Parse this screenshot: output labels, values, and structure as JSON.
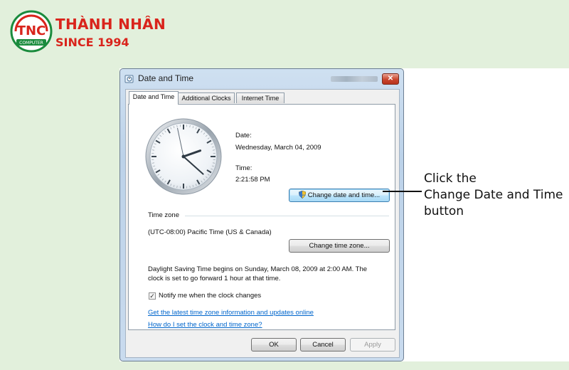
{
  "brand": {
    "logo_text": "TNC",
    "logo_sub": "COMPUTER",
    "name": "THÀNH NHÂN",
    "since": "SINCE 1994",
    "color": "#d9241c"
  },
  "dialog": {
    "title": "Date and Time",
    "close_label": "✕",
    "tabs": [
      {
        "label": "Date and Time",
        "active": true
      },
      {
        "label": "Additional Clocks",
        "active": false
      },
      {
        "label": "Internet Time",
        "active": false
      }
    ],
    "clock": {
      "hour": 2,
      "minute": 21,
      "second": 58
    },
    "date_label": "Date:",
    "date_value": "Wednesday, March 04, 2009",
    "time_label": "Time:",
    "time_value": "2:21:58 PM",
    "change_datetime_button": "Change date and time...",
    "timezone_header": "Time zone",
    "timezone_value": "(UTC-08:00) Pacific Time (US & Canada)",
    "change_timezone_button": "Change time zone...",
    "dst_line1": "Daylight Saving Time begins on Sunday, March 08, 2009 at 2:00 AM. The",
    "dst_line2": "clock is set to go forward 1 hour at that time.",
    "notify_label": "Notify me when the clock changes",
    "notify_checked": true,
    "link1": "Get the latest time zone information and updates online",
    "link2": "How do I set the clock and time zone?",
    "ok_button": "OK",
    "cancel_button": "Cancel",
    "apply_button": "Apply"
  },
  "callout": {
    "line1": "Click the",
    "line2": "Change Date and Time",
    "line3": "button"
  }
}
